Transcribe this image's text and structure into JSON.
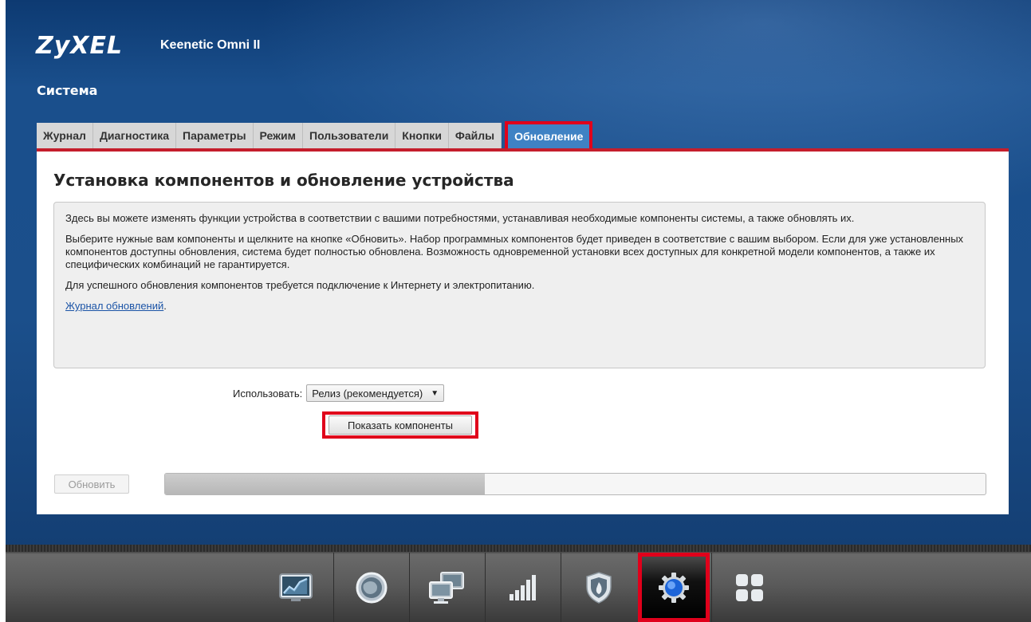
{
  "header": {
    "brand": "ZyXEL",
    "model": "Keenetic Omni II",
    "section_title": "Система"
  },
  "tabs": [
    {
      "label": "Журнал",
      "active": false
    },
    {
      "label": "Диагностика",
      "active": false
    },
    {
      "label": "Параметры",
      "active": false
    },
    {
      "label": "Режим",
      "active": false
    },
    {
      "label": "Пользователи",
      "active": false
    },
    {
      "label": "Кнопки",
      "active": false
    },
    {
      "label": "Файлы",
      "active": false
    },
    {
      "label": "Обновление",
      "active": true
    }
  ],
  "panel": {
    "title": "Установка компонентов и обновление устройства",
    "info": {
      "p1": "Здесь вы можете изменять функции устройства в соответствии с вашими потребностями, устанавливая необходимые компоненты системы, а также обновлять их.",
      "p2": "Выберите нужные вам компоненты и щелкните на кнопке «Обновить». Набор программных компонентов будет приведен в соответствие с вашим выбором. Если для уже установленных компонентов доступны обновления, система будет полностью обновлена. Возможность одновременной установки всех доступных для конкретной модели компонентов, а также их специфических комбинаций не гарантируется.",
      "p3": "Для успешного обновления компонентов требуется подключение к Интернету и электропитанию.",
      "log_link": "Журнал обновлений",
      "log_suffix": "."
    },
    "use_label": "Использовать:",
    "use_selected": "Релиз (рекомендуется)",
    "show_components_label": "Показать компоненты",
    "update_label": "Обновить",
    "progress_fraction": 0.39
  },
  "dock": [
    {
      "icon": "monitor-chart-icon",
      "active": false
    },
    {
      "icon": "globe-icon",
      "active": false
    },
    {
      "icon": "network-computers-icon",
      "active": false
    },
    {
      "icon": "signal-bars-icon",
      "active": false
    },
    {
      "icon": "shield-fire-icon",
      "active": false
    },
    {
      "icon": "gear-icon",
      "active": true
    },
    {
      "icon": "apps-grid-icon",
      "active": false
    }
  ],
  "colors": {
    "accent_red": "#e0001b",
    "tab_active": "#3f82c4",
    "header_blue": "#1a4f8c"
  }
}
